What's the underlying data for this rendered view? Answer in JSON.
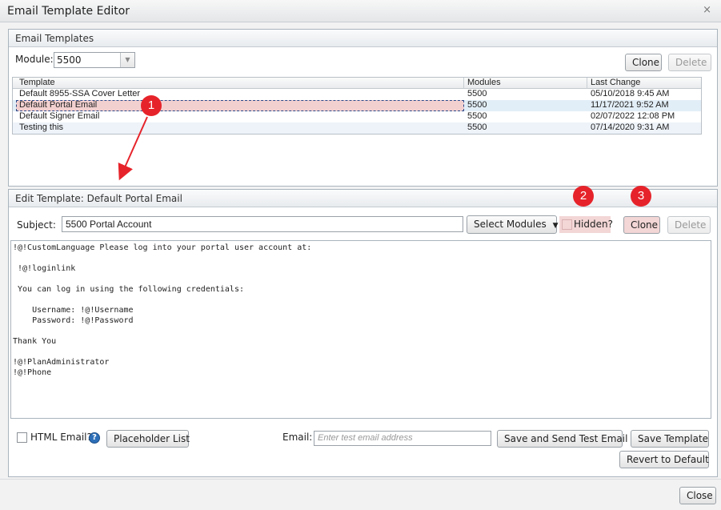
{
  "window": {
    "title": "Email Template Editor",
    "close_glyph": "×"
  },
  "templates_panel": {
    "header": "Email Templates",
    "module_label": "Module:",
    "module_value": "5500",
    "clone_label": "Clone",
    "delete_label": "Delete",
    "columns": [
      "Template",
      "Modules",
      "Last Change"
    ],
    "rows": [
      {
        "template": "Default 8955-SSA Cover Letter",
        "modules": "5500",
        "last_change": "05/10/2018 9:45 AM"
      },
      {
        "template": "Default Portal Email",
        "modules": "5500",
        "last_change": "11/17/2021 9:52 AM"
      },
      {
        "template": "Default Signer Email",
        "modules": "5500",
        "last_change": "02/07/2022 12:08 PM"
      },
      {
        "template": "Testing this",
        "modules": "5500",
        "last_change": "07/14/2020 9:31 AM"
      }
    ]
  },
  "edit_panel": {
    "header": "Edit Template: Default Portal Email",
    "subject_label": "Subject:",
    "subject_value": "5500 Portal Account",
    "select_modules_label": "Select Modules",
    "hidden_label": "Hidden?",
    "clone_label": "Clone",
    "delete_label": "Delete",
    "body_text": "!@!CustomLanguage Please log into your portal user account at:\n\n !@!loginlink\n\n You can log in using the following credentials:\n\n    Username: !@!Username\n    Password: !@!Password\n\nThank You\n\n!@!PlanAdministrator\n!@!Phone",
    "html_email_label": "HTML Email?",
    "placeholder_list_label": "Placeholder List",
    "email_label": "Email:",
    "email_placeholder": "Enter test email address",
    "save_send_label": "Save and Send Test Email",
    "save_template_label": "Save Template",
    "revert_label": "Revert to Default"
  },
  "footer": {
    "close_label": "Close"
  },
  "annotations": {
    "badge1": "1",
    "badge2": "2",
    "badge3": "3",
    "color": "#e6232a"
  }
}
